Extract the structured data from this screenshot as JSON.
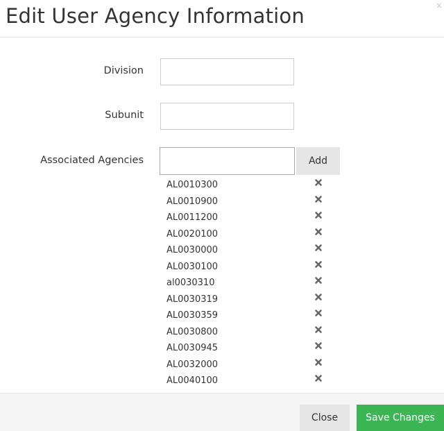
{
  "modal": {
    "title": "Edit User Agency Information",
    "close_glyph": "×"
  },
  "form": {
    "division": {
      "label": "Division",
      "value": "",
      "placeholder": ""
    },
    "subunit": {
      "label": "Subunit",
      "value": "",
      "placeholder": ""
    },
    "associated_agencies": {
      "label": "Associated Agencies",
      "input_value": "",
      "add_label": "Add",
      "items": [
        "AL0010300",
        "AL0010900",
        "AL0011200",
        "AL0020100",
        "AL0030000",
        "AL0030100",
        "al0030310",
        "AL0030319",
        "AL0030359",
        "AL0030800",
        "AL0030945",
        "AL0032000",
        "AL0040100"
      ],
      "remove_icon": "remove-x-icon"
    }
  },
  "footer": {
    "close_label": "Close",
    "save_label": "Save Changes"
  },
  "colors": {
    "save_button": "#3cb554",
    "secondary_button": "#e6e6e6",
    "footer_background": "#f5f5f5",
    "remove_icon": "#666666"
  }
}
